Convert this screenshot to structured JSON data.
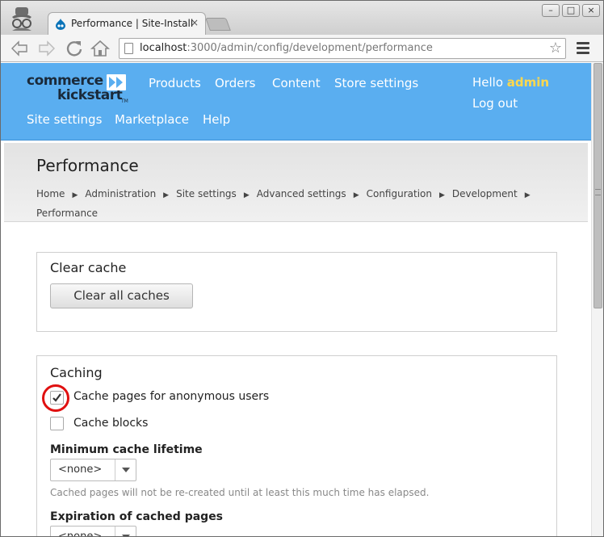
{
  "browser": {
    "tab_title": "Performance | Site-Install",
    "tab_close": "×",
    "url_host": "localhost",
    "url_rest": ":3000/admin/config/development/performance",
    "window_controls": {
      "minimize": "–",
      "maximize": "□",
      "close": "×"
    }
  },
  "header": {
    "logo_line1": "commerce",
    "logo_line2": "kickstart",
    "logo_tm": "TM",
    "nav": [
      "Products",
      "Orders",
      "Content",
      "Store settings",
      "Site settings",
      "Marketplace",
      "Help"
    ],
    "hello_prefix": "Hello ",
    "user_name": "admin",
    "logout": "Log out"
  },
  "page": {
    "title": "Performance",
    "breadcrumb": [
      "Home",
      "Administration",
      "Site settings",
      "Advanced settings",
      "Configuration",
      "Development",
      "Performance"
    ],
    "breadcrumb_separator": "▶"
  },
  "clear_cache": {
    "legend": "Clear cache",
    "button": "Clear all caches"
  },
  "caching": {
    "legend": "Caching",
    "cache_pages_label": "Cache pages for anonymous users",
    "cache_pages_checked": true,
    "cache_blocks_label": "Cache blocks",
    "cache_blocks_checked": false,
    "min_lifetime_label": "Minimum cache lifetime",
    "min_lifetime_value": "<none>",
    "min_lifetime_desc": "Cached pages will not be re-created until at least this much time has elapsed.",
    "expiration_label": "Expiration of cached pages",
    "expiration_value": "<none>"
  },
  "colors": {
    "header_bg": "#5aaef0",
    "user_name": "#ffd84c",
    "highlight_ring": "#e01010"
  }
}
